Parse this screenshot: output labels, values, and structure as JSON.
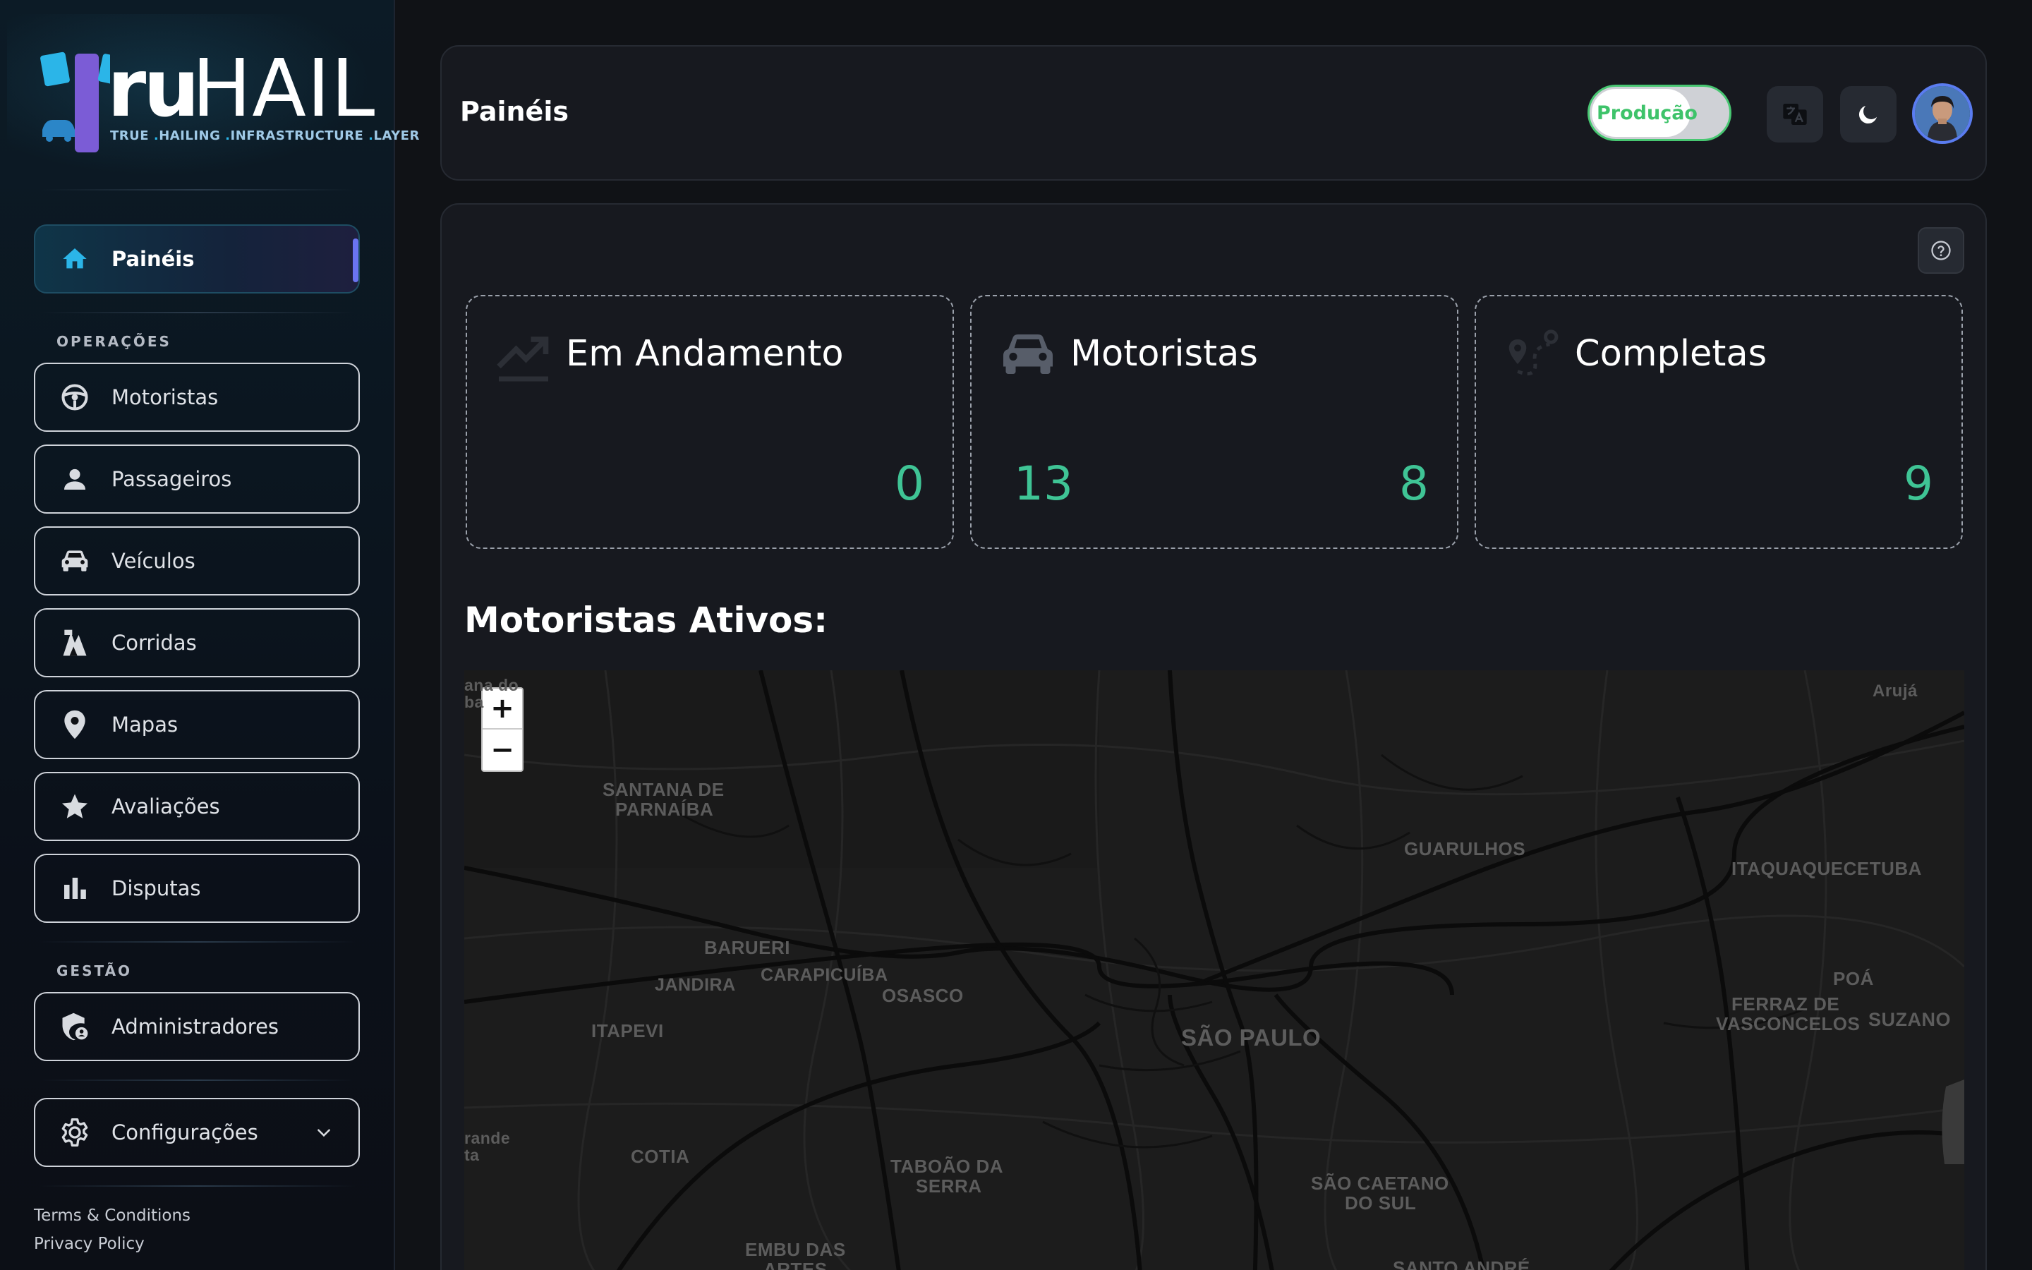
{
  "brand": {
    "name_bold": "ru",
    "name_light": "HAIL",
    "tagline_parts": [
      "TRUE",
      "HAILING",
      "INFRASTRUCTURE",
      "LAYER"
    ]
  },
  "sidebar": {
    "home": {
      "label": "Painéis",
      "icon": "home-icon"
    },
    "sections": [
      {
        "label": "OPERAÇÕES",
        "items": [
          {
            "label": "Motoristas",
            "icon": "steering-wheel-icon"
          },
          {
            "label": "Passageiros",
            "icon": "person-icon"
          },
          {
            "label": "Veículos",
            "icon": "car-icon"
          },
          {
            "label": "Corridas",
            "icon": "route-icon"
          },
          {
            "label": "Mapas",
            "icon": "map-pin-icon"
          },
          {
            "label": "Avaliações",
            "icon": "star-icon"
          },
          {
            "label": "Disputas",
            "icon": "bar-chart-icon"
          }
        ]
      },
      {
        "label": "GESTÃO",
        "items": [
          {
            "label": "Administradores",
            "icon": "admin-shield-icon"
          }
        ]
      }
    ],
    "settings": {
      "label": "Configurações",
      "icon": "gear-icon"
    },
    "footer": {
      "terms": "Terms & Conditions",
      "privacy": "Privacy Policy"
    }
  },
  "header": {
    "title": "Painéis",
    "environment_label": "Produção",
    "environment_on": true,
    "translate_icon": "translate-icon",
    "theme_icon": "moon-icon"
  },
  "dashboard": {
    "cards": [
      {
        "title": "Em Andamento",
        "icon": "trending-up-icon",
        "value_right": "0"
      },
      {
        "title": "Motoristas",
        "icon": "car-icon",
        "value_left": "13",
        "value_right": "8"
      },
      {
        "title": "Completas",
        "icon": "route-pin-icon",
        "value_right": "9"
      }
    ],
    "map_title": "Motoristas Ativos:",
    "map": {
      "zoom_in": "+",
      "zoom_out": "−",
      "labels": [
        "Arujá",
        "SANTANA DE",
        "PARNAÍBA",
        "GUARULHOS",
        "ITAQUAQUECETUBA",
        "BARUERI",
        "JANDIRA",
        "CARAPICUÍBA",
        "OSASCO",
        "ITAPEVI",
        "POÁ",
        "FERRAZ DE",
        "VASCONCELOS",
        "SUZANO",
        "SÃO PAULO",
        "COTIA",
        "TABOÃO DA",
        "SERRA",
        "SÃO CAETANO",
        "DO SUL",
        "EMBU DAS",
        "ARTES",
        "SANTO ANDRÉ",
        "rande",
        "ta",
        "ana do",
        "ba"
      ]
    }
  },
  "colors": {
    "accent_green": "#3fc495",
    "toggle_green": "#48c772",
    "active_bar": "#6a74f0",
    "brand_blue": "#2bb5e8",
    "brand_purple": "#7b5cd6"
  }
}
